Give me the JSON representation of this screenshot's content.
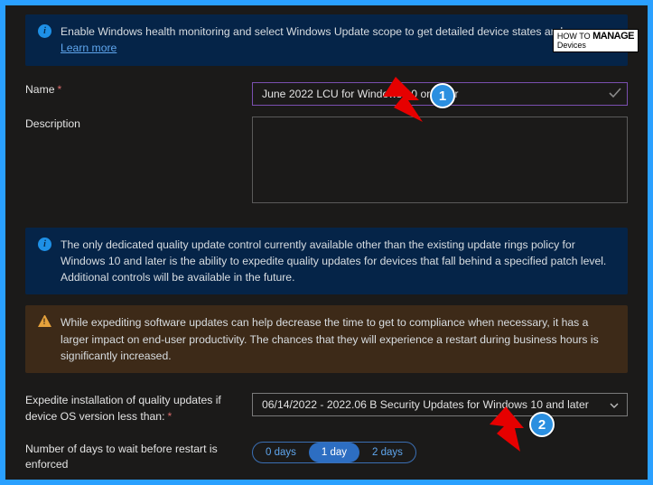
{
  "watermark": {
    "top": "HOW TO",
    "mid": "MANAGE",
    "bot": "Devices"
  },
  "info1": {
    "text": "Enable Windows health monitoring and select Windows Update scope to get detailed device states and errors.",
    "link": "Learn more"
  },
  "form": {
    "name_label": "Name",
    "name_value": "June 2022 LCU for Windows 10 or Later",
    "desc_label": "Description",
    "desc_value": ""
  },
  "info2": {
    "text": "The only dedicated quality update control currently available other than the existing update rings policy for Windows 10 and later is the ability to expedite quality updates for devices that fall behind a specified patch level. Additional controls will be available in the future."
  },
  "warn": {
    "text": "While expediting software updates can help decrease the time to get to compliance when necessary, it has a larger impact on end-user productivity. The chances that they will experience a restart during business hours is significantly increased."
  },
  "expedite": {
    "label": "Expedite installation of quality updates if device OS version less than:",
    "value": "06/14/2022 - 2022.06 B Security Updates for Windows 10 and later"
  },
  "wait": {
    "label": "Number of days to wait before restart is enforced",
    "options": [
      "0 days",
      "1 day",
      "2 days"
    ],
    "selected_index": 1
  },
  "callouts": {
    "one": "1",
    "two": "2"
  }
}
